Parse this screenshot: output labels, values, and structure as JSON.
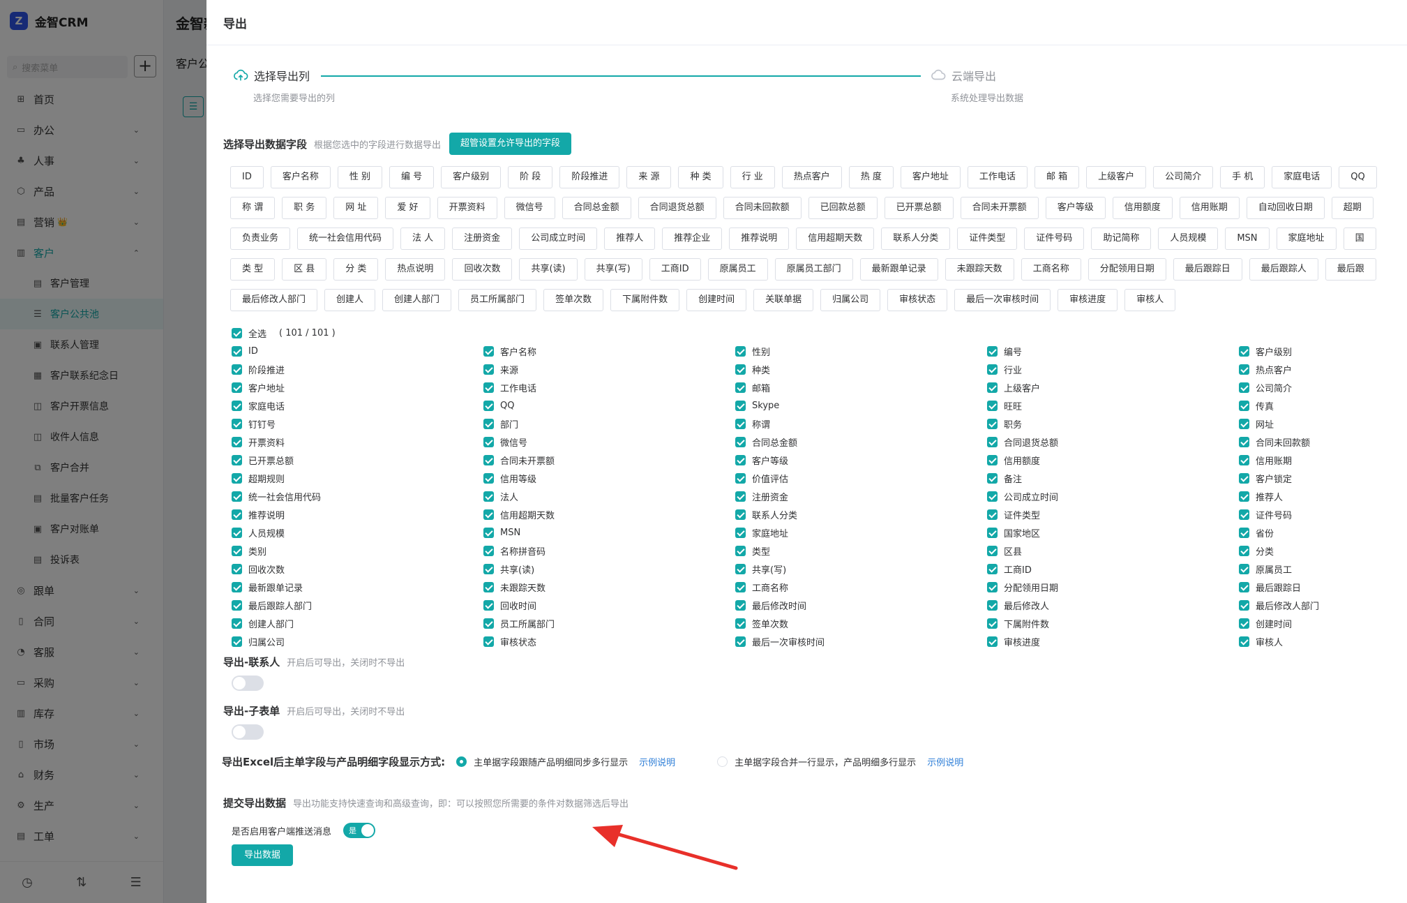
{
  "app": {
    "logo_text": "金智CRM",
    "logo_glyph": "Z",
    "search_placeholder": "搜索菜单",
    "add_label": "+",
    "page_title": "金智新",
    "page_subtitle": "客户公",
    "menu": [
      {
        "label": "首页",
        "icon": "home-icon",
        "glyph": "⊞",
        "arrow": ""
      },
      {
        "label": "办公",
        "icon": "office-icon",
        "glyph": "▭",
        "arrow": "⌄"
      },
      {
        "label": "人事",
        "icon": "people-icon",
        "glyph": "♣",
        "arrow": "⌄"
      },
      {
        "label": "产品",
        "icon": "product-icon",
        "glyph": "⬡",
        "arrow": "⌄"
      },
      {
        "label": "营销",
        "icon": "marketing-icon",
        "glyph": "▤",
        "arrow": "⌄",
        "badge": "👑"
      },
      {
        "label": "客户",
        "icon": "customer-icon",
        "glyph": "▥",
        "arrow": "⌃"
      }
    ],
    "submenu": [
      {
        "label": "客户管理",
        "glyph": "▤"
      },
      {
        "label": "客户公共池",
        "glyph": "☰"
      },
      {
        "label": "联系人管理",
        "glyph": "▣"
      },
      {
        "label": "客户联系纪念日",
        "glyph": "▦"
      },
      {
        "label": "客户开票信息",
        "glyph": "◫"
      },
      {
        "label": "收件人信息",
        "glyph": "◫"
      },
      {
        "label": "客户合并",
        "glyph": "⧉"
      },
      {
        "label": "批量客户任务",
        "glyph": "▤"
      },
      {
        "label": "客户对账单",
        "glyph": "▣"
      },
      {
        "label": "投诉表",
        "glyph": "▤"
      }
    ],
    "menu2": [
      {
        "label": "跟单",
        "glyph": "◎"
      },
      {
        "label": "合同",
        "glyph": "▯"
      },
      {
        "label": "客服",
        "glyph": "◔"
      },
      {
        "label": "采购",
        "glyph": "▭"
      },
      {
        "label": "库存",
        "glyph": "▥"
      },
      {
        "label": "市场",
        "glyph": "▯"
      },
      {
        "label": "财务",
        "glyph": "⌂"
      },
      {
        "label": "生产",
        "glyph": "⚙"
      },
      {
        "label": "工单",
        "glyph": "▤"
      }
    ],
    "arrow_down": "⌄",
    "bottom_icons": [
      "◷",
      "⇅",
      "☰"
    ]
  },
  "drawer": {
    "title": "导出",
    "steps": [
      {
        "title": "选择导出列",
        "desc": "选择您需要导出的列"
      },
      {
        "title": "云端导出",
        "desc": "系统处理导出数据"
      }
    ],
    "fields_section": {
      "title": "选择导出数据字段",
      "hint": "根据您选中的字段进行数据导出",
      "button": "超管设置允许导出的字段"
    },
    "tag_rows": [
      [
        "ID",
        "客户名称",
        "性 别",
        "编 号",
        "客户级别",
        "阶 段",
        "阶段推进",
        "来 源",
        "种 类",
        "行 业",
        "热点客户",
        "热 度",
        "客户地址",
        "工作电话",
        "邮 箱",
        "上级客户",
        "公司简介",
        "手 机",
        "家庭电话",
        "QQ"
      ],
      [
        "称 谓",
        "职 务",
        "网 址",
        "爱 好",
        "开票资料",
        "微信号",
        "合同总金额",
        "合同退货总额",
        "合同未回款额",
        "已回款总额",
        "已开票总额",
        "合同未开票额",
        "客户等级",
        "信用额度",
        "信用账期",
        "自动回收日期",
        "超期"
      ],
      [
        "负责业务",
        "统一社会信用代码",
        "法 人",
        "注册资金",
        "公司成立时间",
        "推荐人",
        "推荐企业",
        "推荐说明",
        "信用超期天数",
        "联系人分类",
        "证件类型",
        "证件号码",
        "助记简称",
        "人员规模",
        "MSN",
        "家庭地址",
        "国"
      ],
      [
        "类 型",
        "区 县",
        "分 类",
        "热点说明",
        "回收次数",
        "共享(读)",
        "共享(写)",
        "工商ID",
        "原属员工",
        "原属员工部门",
        "最新跟单记录",
        "未跟踪天数",
        "工商名称",
        "分配领用日期",
        "最后跟踪日",
        "最后跟踪人",
        "最后跟"
      ],
      [
        "最后修改人部门",
        "创建人",
        "创建人部门",
        "员工所属部门",
        "签单次数",
        "下属附件数",
        "创建时间",
        "关联单据",
        "归属公司",
        "审核状态",
        "最后一次审核时间",
        "审核进度",
        "审核人"
      ]
    ],
    "select_all_label": "全选",
    "select_all_count": "( 101 / 101 )",
    "checkbox_items": [
      "ID",
      "客户名称",
      "性别",
      "编号",
      "客户级别",
      "阶段推进",
      "来源",
      "种类",
      "行业",
      "热点客户",
      "客户地址",
      "工作电话",
      "邮箱",
      "上级客户",
      "公司简介",
      "家庭电话",
      "QQ",
      "Skype",
      "旺旺",
      "传真",
      "钉钉号",
      "部门",
      "称谓",
      "职务",
      "网址",
      "开票资料",
      "微信号",
      "合同总金额",
      "合同退货总额",
      "合同未回款额",
      "已开票总额",
      "合同未开票额",
      "客户等级",
      "信用额度",
      "信用账期",
      "超期规则",
      "信用等级",
      "价值评估",
      "备注",
      "客户锁定",
      "统一社会信用代码",
      "法人",
      "注册资金",
      "公司成立时间",
      "推荐人",
      "推荐说明",
      "信用超期天数",
      "联系人分类",
      "证件类型",
      "证件号码",
      "人员规模",
      "MSN",
      "家庭地址",
      "国家地区",
      "省份",
      "类别",
      "名称拼音码",
      "类型",
      "区县",
      "分类",
      "回收次数",
      "共享(读)",
      "共享(写)",
      "工商ID",
      "原属员工",
      "最新跟单记录",
      "未跟踪天数",
      "工商名称",
      "分配领用日期",
      "最后跟踪日",
      "最后跟踪人部门",
      "回收时间",
      "最后修改时间",
      "最后修改人",
      "最后修改人部门",
      "创建人部门",
      "员工所属部门",
      "签单次数",
      "下属附件数",
      "创建时间",
      "归属公司",
      "审核状态",
      "最后一次审核时间",
      "审核进度",
      "审核人"
    ],
    "export_contacts": {
      "title": "导出-联系人",
      "hint": "开启后可导出，关闭时不导出",
      "enabled": false
    },
    "export_subform": {
      "title": "导出-子表单",
      "hint": "开启后可导出，关闭时不导出",
      "enabled": false
    },
    "display_mode": {
      "label": "导出Excel后主单字段与产品明细字段显示方式:",
      "options": [
        {
          "label": "主单据字段跟随产品明细同步多行显示",
          "link": "示例说明",
          "selected": true
        },
        {
          "label": "主单据字段合并一行显示，产品明细多行显示",
          "link": "示例说明",
          "selected": false
        }
      ]
    },
    "submit": {
      "title": "提交导出数据",
      "hint": "导出功能支持快速查询和高级查询，即：可以按照您所需要的条件对数据筛选后导出",
      "push_label": "是否启用客户端推送消息",
      "push_on_text": "是",
      "push_enabled": true,
      "export_button": "导出数据"
    }
  },
  "colors": {
    "accent": "#13a8a8",
    "link": "#2f7fd8",
    "annotation_arrow": "#e8302a"
  }
}
